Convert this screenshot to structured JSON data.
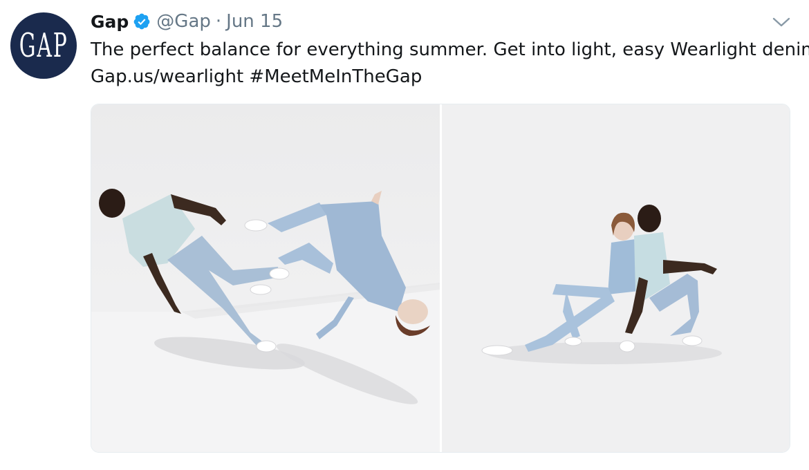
{
  "tweet": {
    "avatar_text": "GAP",
    "display_name": "Gap",
    "handle": "@Gap",
    "separator": "·",
    "date": "Jun 15",
    "text_line_1": "The perfect balance for everything summer. Get into light, easy Wearlight denim:",
    "link_text": "Gap.us/wearlight",
    "hashtag": "#MeetMeInTheGap"
  },
  "icons": {
    "verified": "verified-badge-icon",
    "more": "chevron-down-icon"
  },
  "colors": {
    "verified_blue": "#1da1f2",
    "avatar_navy": "#1a2a4d",
    "secondary_text": "#657786",
    "primary_text": "#14171a"
  }
}
